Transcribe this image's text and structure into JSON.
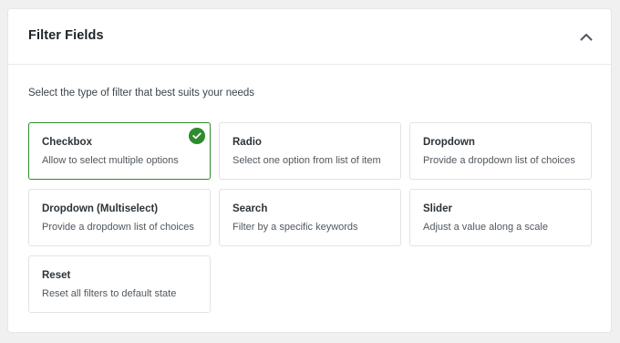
{
  "panel": {
    "title": "Filter Fields",
    "subtitle": "Select the type of filter that best suits your needs",
    "collapse_icon": "chevron-up-icon"
  },
  "accent_color": "#2e8b2e",
  "filter_types": [
    {
      "title": "Checkbox",
      "description": "Allow to select multiple options",
      "selected": true
    },
    {
      "title": "Radio",
      "description": "Select one option from list of item",
      "selected": false
    },
    {
      "title": "Dropdown",
      "description": "Provide a dropdown list of choices",
      "selected": false
    },
    {
      "title": "Dropdown (Multiselect)",
      "description": "Provide a dropdown list of choices",
      "selected": false
    },
    {
      "title": "Search",
      "description": "Filter by a specific keywords",
      "selected": false
    },
    {
      "title": "Slider",
      "description": "Adjust a value along a scale",
      "selected": false
    },
    {
      "title": "Reset",
      "description": "Reset all filters to default state",
      "selected": false
    }
  ]
}
